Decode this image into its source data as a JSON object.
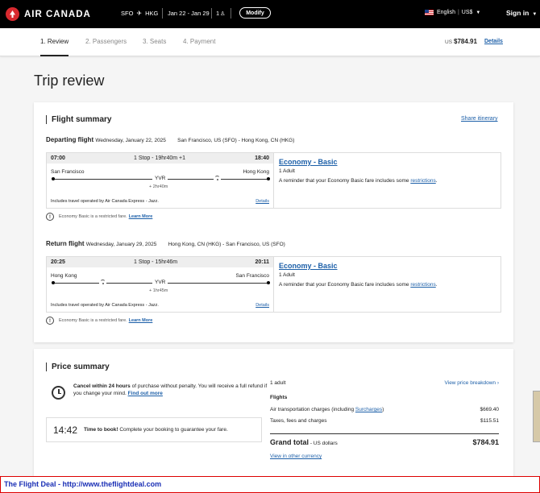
{
  "header": {
    "brand": "AIR CANADA",
    "origin": "SFO",
    "destination": "HKG",
    "dates": "Jan 22 - Jan 29",
    "passengers": "1",
    "modify_label": "Modify",
    "language": "English",
    "currency": "US$",
    "signin_label": "Sign in"
  },
  "steps": [
    {
      "label": "1. Review",
      "active": true
    },
    {
      "label": "2. Passengers"
    },
    {
      "label": "3. Seats"
    },
    {
      "label": "4. Payment"
    }
  ],
  "total": {
    "currency": "US",
    "amount": "$784.91",
    "details_label": "Details"
  },
  "page_title": "Trip review",
  "flight_summary": {
    "title": "Flight summary",
    "share_label": "Share itinerary",
    "legs": [
      {
        "label": "Departing flight",
        "date": "Wednesday, January 22, 2025",
        "route": "San Francisco, US (SFO) - Hong Kong, CN (HKG)",
        "dep_time": "07:00",
        "stops": "1 Stop - 19hr40m +1",
        "arr_time": "18:40",
        "origin_city": "San Francisco",
        "dest_city": "Hong Kong",
        "stop_code": "YVR",
        "layover": "+ 2hr40m",
        "operated": "Includes travel operated by Air Canada Express - Jazz.",
        "details_label": "Details",
        "fare_name": "Economy - Basic",
        "fare_pax": "1 Adult",
        "fare_note": "A reminder that your Economy Basic fare includes some",
        "fare_link": "restrictions",
        "notice": "Economy Basic is a restricted fare.",
        "notice_link": "Learn More"
      },
      {
        "label": "Return flight",
        "date": "Wednesday, January 29, 2025",
        "route": "Hong Kong, CN (HKG) - San Francisco, US (SFO)",
        "dep_time": "20:25",
        "stops": "1 Stop - 15hr46m",
        "arr_time": "20:11",
        "origin_city": "Hong Kong",
        "dest_city": "San Francisco",
        "stop_code": "YVR",
        "layover": "+ 1hr45m",
        "operated": "Includes travel operated by Air Canada Express - Jazz.",
        "details_label": "Details",
        "fare_name": "Economy - Basic",
        "fare_pax": "1 Adult",
        "fare_note": "A reminder that your Economy Basic fare includes some",
        "fare_link": "restrictions",
        "notice": "Economy Basic is a restricted fare.",
        "notice_link": "Learn More"
      }
    ]
  },
  "price_summary": {
    "title": "Price summary",
    "cancel_bold": "Cancel within 24 hours",
    "cancel_text": "of purchase without penalty. You will receive a full refund if you change your mind.",
    "cancel_link": "Find out more",
    "timer": "14:42",
    "timer_bold": "Time to book!",
    "timer_text": "Complete your booking to guarantee your fare.",
    "pax": "1 adult",
    "breakdown_label": "View price breakdown",
    "flights_label": "Flights",
    "air_label": "Air transportation charges (including",
    "air_link": "Surcharges",
    "air_amount": "$669.40",
    "taxes_label": "Taxes, fees and charges",
    "taxes_amount": "$115.51",
    "grand_label": "Grand total",
    "grand_sub": "- US dollars",
    "grand_amount": "$784.91",
    "currency_link": "View in other currency"
  },
  "footer": {
    "text": "The Flight Deal - http://www.theflightdeal.com"
  }
}
